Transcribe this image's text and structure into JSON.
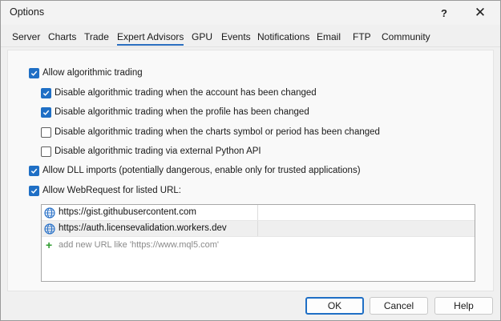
{
  "window": {
    "title": "Options",
    "help_glyph": "?",
    "close_glyph": "✕"
  },
  "tabs": [
    {
      "label": "Server"
    },
    {
      "label": "Charts"
    },
    {
      "label": "Trade"
    },
    {
      "label": "Expert Advisors",
      "active": true
    },
    {
      "label": "GPU"
    },
    {
      "label": "Events"
    },
    {
      "label": "Notifications"
    },
    {
      "label": "Email"
    },
    {
      "label": "FTP"
    },
    {
      "label": "Community"
    }
  ],
  "options": [
    {
      "label": "Allow algorithmic trading",
      "checked": true
    },
    {
      "label": "Disable algorithmic trading when the account has been changed",
      "checked": true
    },
    {
      "label": "Disable algorithmic trading when the profile has been changed",
      "checked": true
    },
    {
      "label": "Disable algorithmic trading when the charts symbol or period has been changed",
      "checked": false
    },
    {
      "label": "Disable algorithmic trading via external Python API",
      "checked": false
    },
    {
      "label": "Allow DLL imports (potentially dangerous, enable only for trusted applications)",
      "checked": true
    },
    {
      "label": "Allow WebRequest for listed URL:",
      "checked": true
    }
  ],
  "url_list": {
    "items": [
      {
        "url": "https://gist.githubusercontent.com",
        "icon": "globe-icon"
      },
      {
        "url": "https://auth.licensevalidation.workers.dev",
        "icon": "globe-icon",
        "selected": true
      }
    ],
    "add_placeholder": "add new URL like 'https://www.mql5.com'"
  },
  "buttons": {
    "ok": "OK",
    "cancel": "Cancel",
    "help": "Help"
  },
  "colors": {
    "accent": "#1f6fc5",
    "add_icon": "#2e9b2e"
  }
}
